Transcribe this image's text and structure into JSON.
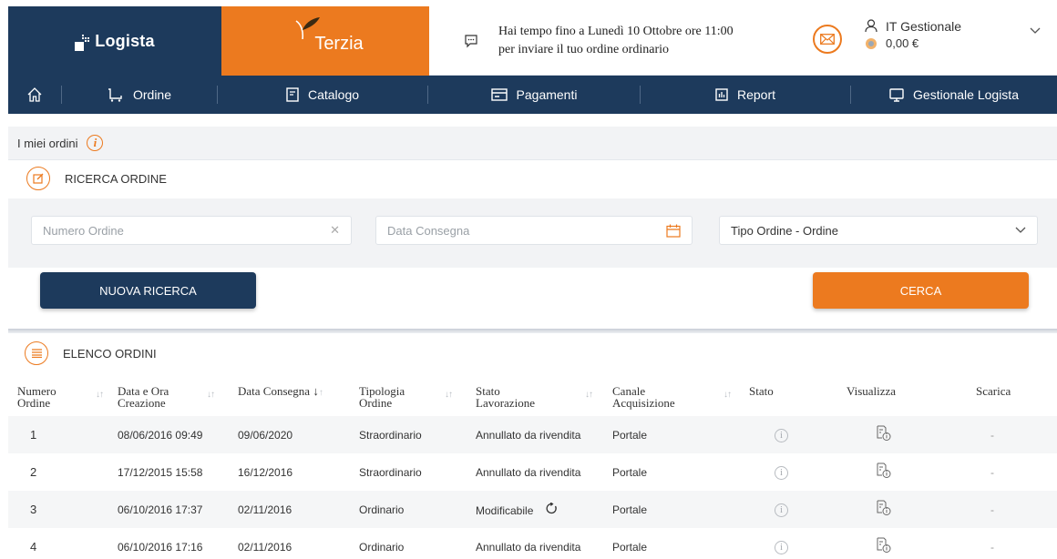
{
  "header": {
    "brand_logista": "Logista",
    "brand_terzia": "Terzia",
    "notice_line1": "Hai tempo fino a Lunedì 10 Ottobre ore 11:00",
    "notice_line2": "per inviare il tuo ordine ordinario",
    "user_name": "IT Gestionale",
    "balance": "0,00 €"
  },
  "nav": {
    "items": [
      {
        "label": "Ordine",
        "icon": "cart-icon"
      },
      {
        "label": "Catalogo",
        "icon": "catalog-icon"
      },
      {
        "label": "Pagamenti",
        "icon": "card-icon"
      },
      {
        "label": "Report",
        "icon": "chart-icon"
      },
      {
        "label": "Gestionale Logista",
        "icon": "monitor-icon"
      }
    ]
  },
  "breadcrumb": {
    "label": "I miei ordini"
  },
  "search": {
    "title": "RICERCA ORDINE",
    "numero_placeholder": "Numero Ordine",
    "data_placeholder": "Data Consegna",
    "tipo_value": "Tipo Ordine - Ordine",
    "new_button": "NUOVA RICERCA",
    "search_button": "CERCA"
  },
  "orders": {
    "title": "ELENCO ORDINI",
    "columns": [
      {
        "line1": "Numero",
        "line2": "Ordine"
      },
      {
        "line1": "Data e Ora",
        "line2": "Creazione"
      },
      {
        "line1": "Data Consegna",
        "line2": ""
      },
      {
        "line1": "Tipologia",
        "line2": "Ordine"
      },
      {
        "line1": "Stato",
        "line2": "Lavorazione"
      },
      {
        "line1": "Canale",
        "line2": "Acquisizione"
      },
      {
        "line1": "Stato",
        "line2": ""
      },
      {
        "line1": "Visualizza",
        "line2": ""
      },
      {
        "line1": "Scarica",
        "line2": ""
      }
    ],
    "rows": [
      {
        "num": "1",
        "created": "08/06/2016 09:49",
        "delivery": "09/06/2020",
        "type": "Straordinario",
        "status": "Annullato da rivendita",
        "channel": "Portale",
        "download": "-"
      },
      {
        "num": "2",
        "created": "17/12/2015 15:58",
        "delivery": "16/12/2016",
        "type": "Straordinario",
        "status": "Annullato da rivendita",
        "channel": "Portale",
        "download": "-"
      },
      {
        "num": "3",
        "created": "06/10/2016 17:37",
        "delivery": "02/11/2016",
        "type": "Ordinario",
        "status": "Modificabile",
        "channel": "Portale",
        "download": "-"
      },
      {
        "num": "4",
        "created": "06/10/2016 17:16",
        "delivery": "02/11/2016",
        "type": "Ordinario",
        "status": "Annullato da rivendita",
        "channel": "Portale",
        "download": "-"
      }
    ]
  },
  "colors": {
    "navy": "#1d3a5c",
    "orange": "#ec7a1f"
  }
}
